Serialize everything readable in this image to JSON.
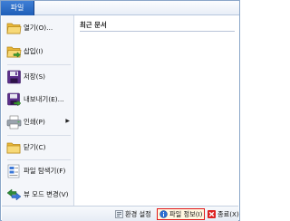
{
  "header": {
    "file_tab_label": "파일"
  },
  "menu": {
    "items": [
      {
        "label": "열기(O)...",
        "icon": "open-folder-icon"
      },
      {
        "label": "삽입(I)",
        "icon": "insert-folder-icon"
      },
      {
        "label": "저장(S)",
        "icon": "floppy-disk-icon"
      },
      {
        "label": "내보내기(E)...",
        "icon": "export-disk-icon"
      },
      {
        "label": "인쇄(P)",
        "icon": "printer-icon",
        "submenu_arrow": "▶"
      },
      {
        "label": "닫기(C)",
        "icon": "folder-icon"
      },
      {
        "label": "파일 탐색기(F)",
        "icon": "file-explorer-icon"
      },
      {
        "label": "뷰 모드 변경(V)",
        "icon": "view-mode-icon"
      }
    ]
  },
  "recent": {
    "title": "최근 문서"
  },
  "footer": {
    "settings_label": "환경 설정",
    "file_info_label": "파일 정보(I)",
    "exit_label": "종료(X)"
  },
  "colors": {
    "file_tab": "#2b6cc4",
    "highlight_border": "#e01818",
    "folder": "#f2c94c",
    "disk": "#5b2e8a",
    "exit_red": "#d22"
  }
}
